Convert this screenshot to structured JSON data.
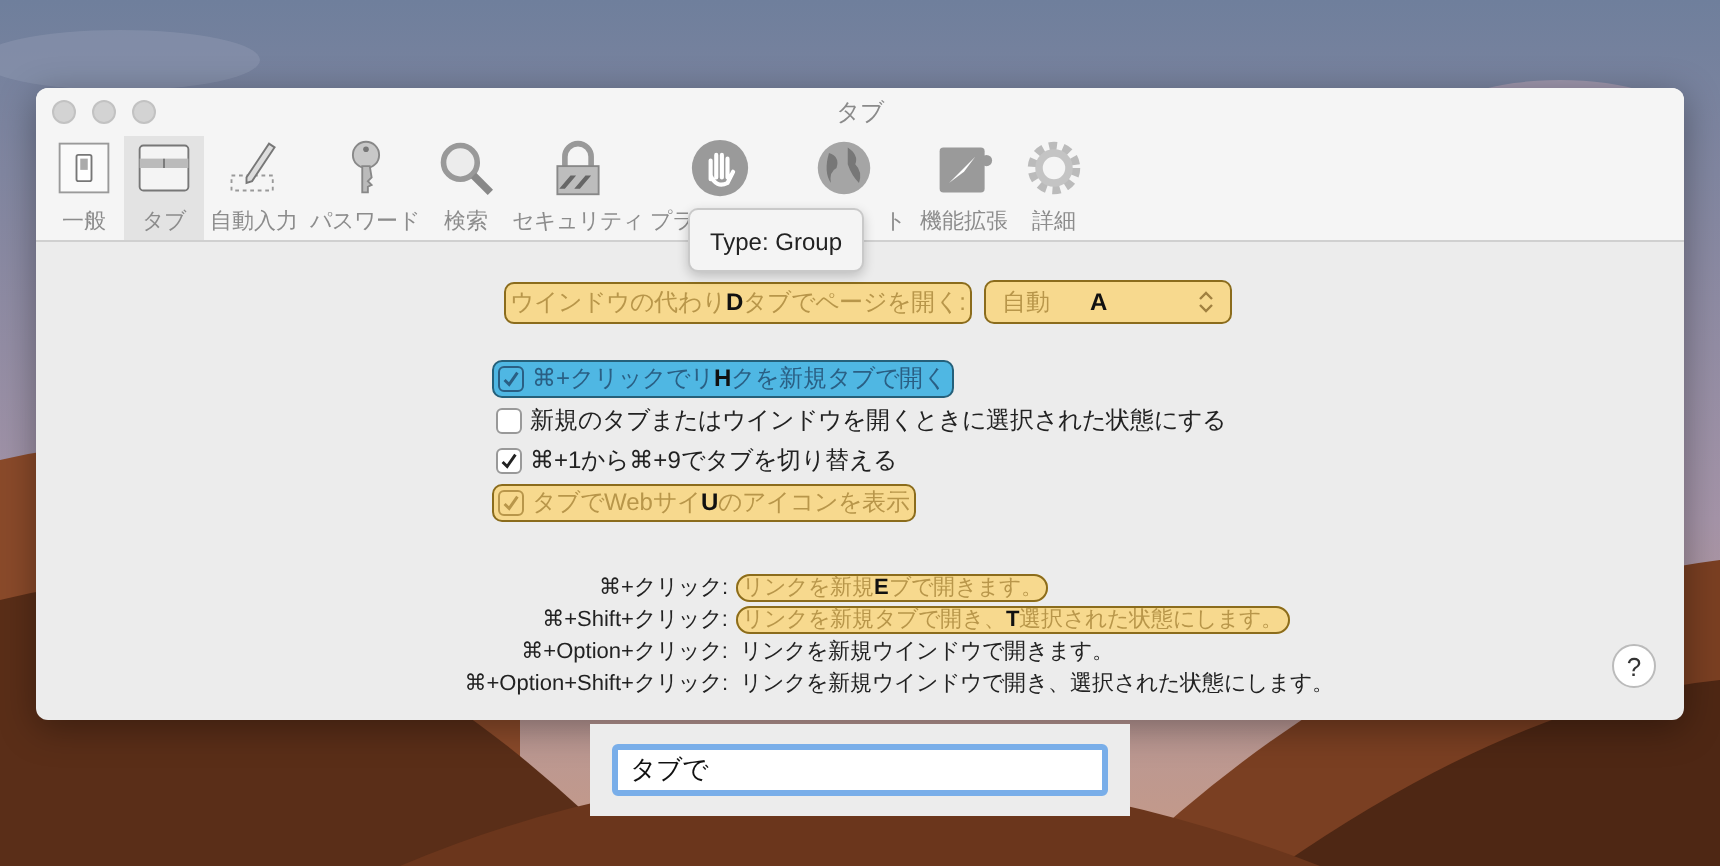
{
  "window": {
    "title": "タブ"
  },
  "toolbar": [
    {
      "kind": "general",
      "label": "一般",
      "selected": false
    },
    {
      "kind": "tabs",
      "label": "タブ",
      "selected": true
    },
    {
      "kind": "autofill",
      "label": "自動入力",
      "selected": false
    },
    {
      "kind": "passwords",
      "label": "パスワード",
      "selected": false
    },
    {
      "kind": "search",
      "label": "検索",
      "selected": false
    },
    {
      "kind": "security",
      "label": "セキュリティ",
      "selected": false
    },
    {
      "kind": "privacy",
      "label": "プラ",
      "selected": false
    },
    {
      "kind": "websites",
      "label": "ト",
      "selected": false
    },
    {
      "kind": "extensions",
      "label": "機能拡張",
      "selected": false
    },
    {
      "kind": "advanced",
      "label": "詳細",
      "selected": false
    }
  ],
  "tooltip": "Type: Group",
  "open_pages": {
    "label_parts": [
      "ウインドウの代わり",
      "タブでページを開く:"
    ],
    "label_hint": "D",
    "popup_value": "自動",
    "popup_hint": "A"
  },
  "options": [
    {
      "parts": [
        "⌘+クリックでリ",
        "クを新規タブで開く"
      ],
      "hint": "H",
      "checked": true,
      "color": "#4fb7e3"
    },
    {
      "parts": [
        "新規のタブまたはウインドウを開くときに選択された状態にする"
      ],
      "checked": false
    },
    {
      "parts": [
        "⌘+1から⌘+9でタブを切り替える"
      ],
      "checked": true
    },
    {
      "parts": [
        "タブでWebサイ",
        "のアイコンを表示"
      ],
      "hint": "U",
      "checked": true,
      "color": "#f7d98e"
    }
  ],
  "shortcuts": [
    {
      "keys": "⌘+クリック:",
      "parts": [
        "リンクを新規",
        "ブで開きます。"
      ],
      "hint": "E",
      "color": "#f7d98e"
    },
    {
      "keys": "⌘+Shift+クリック:",
      "parts": [
        "リンクを新規タブで開き、",
        "選択された状態にします。"
      ],
      "hint": "T",
      "color": "#f7d98e"
    },
    {
      "keys": "⌘+Option+クリック:",
      "parts": [
        "リンクを新規ウインドウで開きます。"
      ]
    },
    {
      "keys": "⌘+Option+Shift+クリック:",
      "parts": [
        "リンクを新規ウインドウで開き、選択された状態にします。"
      ]
    }
  ],
  "help_button": "?",
  "search_field": {
    "value": "タブで"
  }
}
